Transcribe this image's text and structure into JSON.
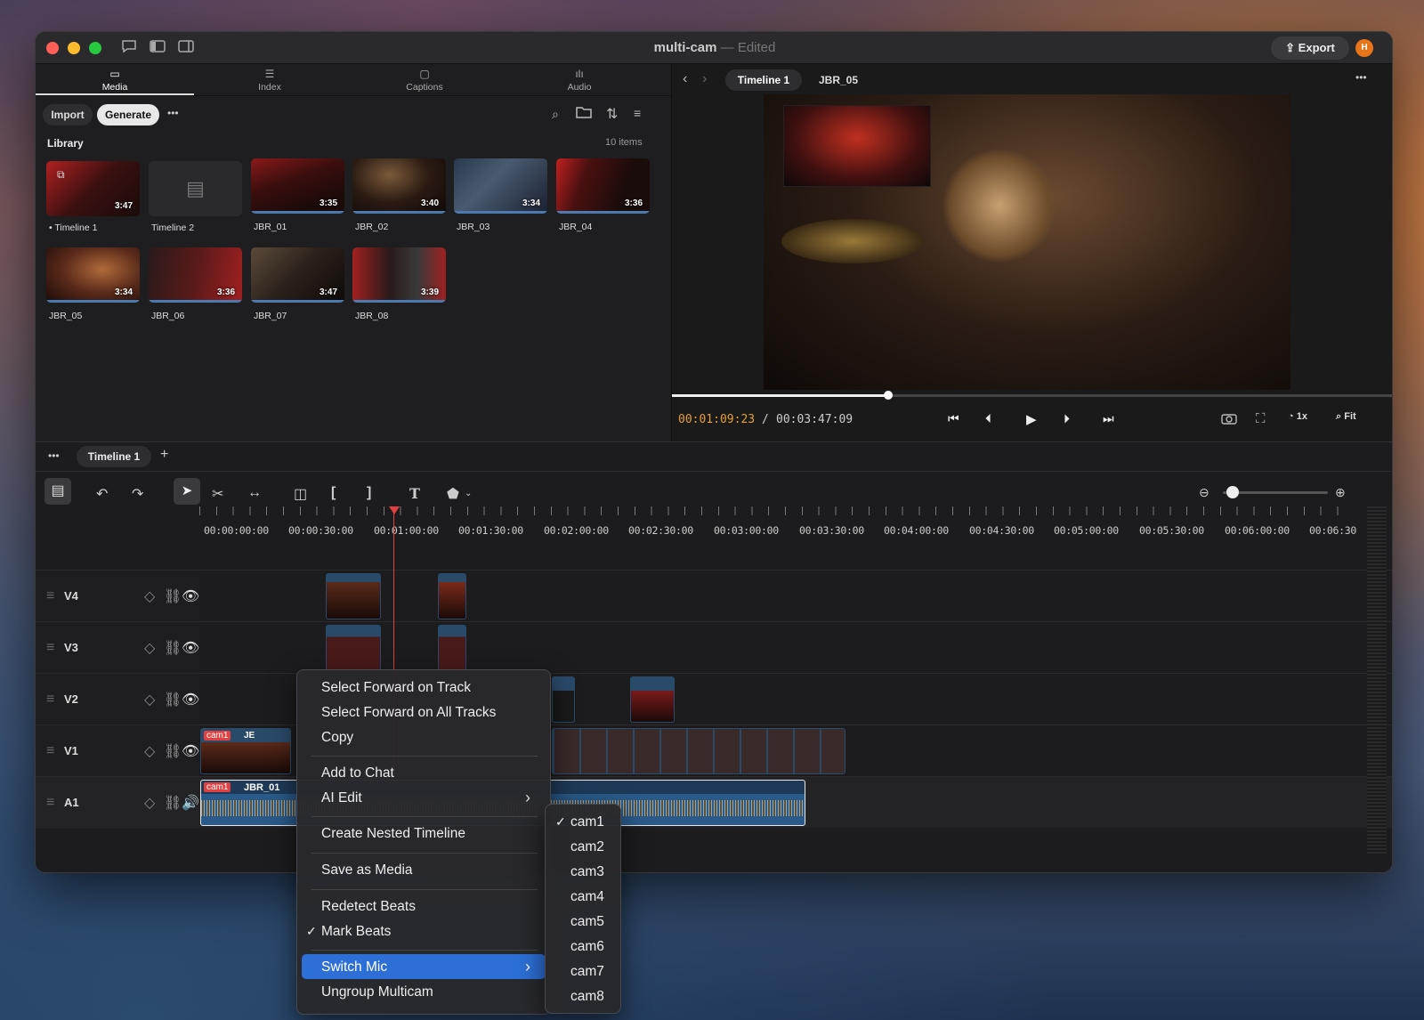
{
  "window": {
    "title": "multi-cam",
    "edited": "— Edited",
    "export_label": "Export",
    "avatar": "H"
  },
  "left_tabs": [
    {
      "label": "Media",
      "icon": "folder-icon"
    },
    {
      "label": "Index",
      "icon": "list-icon"
    },
    {
      "label": "Captions",
      "icon": "captions-icon"
    },
    {
      "label": "Audio",
      "icon": "audio-icon"
    }
  ],
  "library": {
    "import_label": "Import",
    "generate_label": "Generate",
    "more": "•••",
    "heading": "Library",
    "count": "10 items",
    "items": [
      {
        "name": "• Timeline 1",
        "duration": "3:47"
      },
      {
        "name": "Timeline 2",
        "duration": ""
      },
      {
        "name": "JBR_01",
        "duration": "3:35"
      },
      {
        "name": "JBR_02",
        "duration": "3:40"
      },
      {
        "name": "JBR_03",
        "duration": "3:34"
      },
      {
        "name": "JBR_04",
        "duration": "3:36"
      },
      {
        "name": "JBR_05",
        "duration": "3:34"
      },
      {
        "name": "JBR_06",
        "duration": "3:36"
      },
      {
        "name": "JBR_07",
        "duration": "3:47"
      },
      {
        "name": "JBR_08",
        "duration": "3:39"
      }
    ]
  },
  "viewer": {
    "tab_active": "Timeline 1",
    "tab_other": "JBR_05",
    "timecode_current": "00:01:09:23",
    "timecode_sep": "/",
    "timecode_total": "00:03:47:09",
    "speed": "1x",
    "zoom": "Fit",
    "progress": 0.3
  },
  "timeline": {
    "tab": "Timeline 1",
    "more": "•••",
    "add": "+",
    "ruler": [
      "00:00:00:00",
      "00:00:30:00",
      "00:01:00:00",
      "00:01:30:00",
      "00:02:00:00",
      "00:02:30:00",
      "00:03:00:00",
      "00:03:30:00",
      "00:04:00:00",
      "00:04:30:00",
      "00:05:00:00",
      "00:05:30:00",
      "00:06:00:00",
      "00:06:30"
    ],
    "tracks": [
      "V4",
      "V3",
      "V2",
      "V1",
      "A1"
    ],
    "v1_clip": {
      "cam": "cam1",
      "name": "JE"
    },
    "a1_clip": {
      "cam": "cam1",
      "name": "JBR_01"
    }
  },
  "context_menu": {
    "items": [
      "Select Forward on Track",
      "Select Forward on All Tracks",
      "Copy",
      "Add to Chat",
      "AI Edit",
      "Create Nested Timeline",
      "Save as Media",
      "Redetect Beats",
      "Mark Beats",
      "Switch Mic",
      "Ungroup Multicam"
    ],
    "check": "✓",
    "arrow": "›"
  },
  "submenu": {
    "items": [
      "cam1",
      "cam2",
      "cam3",
      "cam4",
      "cam5",
      "cam6",
      "cam7",
      "cam8"
    ],
    "selected": "cam1"
  },
  "colors": {
    "accent": "#2d6fd6",
    "timecode": "#e8a030",
    "playhead": "#e04040"
  }
}
